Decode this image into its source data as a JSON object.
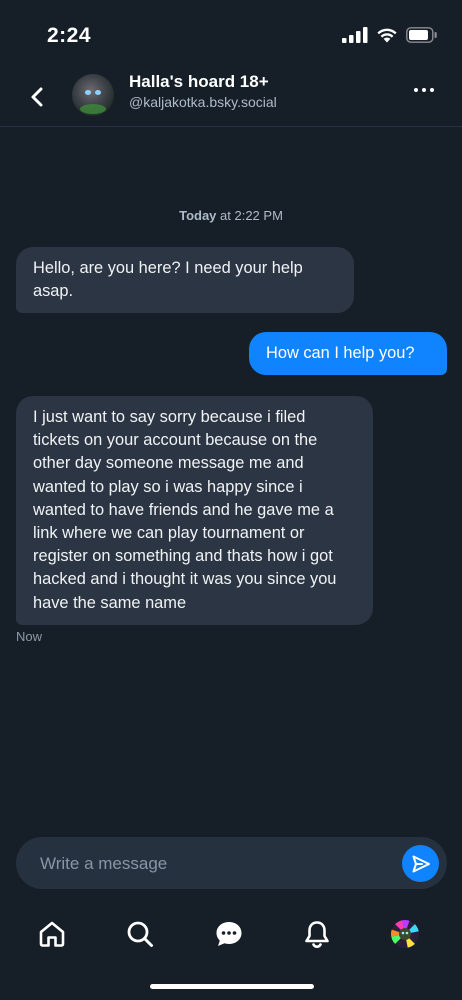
{
  "status_bar": {
    "time": "2:24"
  },
  "header": {
    "title": "Halla's hoard 18+",
    "handle": "@kaljakotka.bsky.social"
  },
  "conversation": {
    "date_label_bold": "Today",
    "date_label_rest": " at 2:22 PM",
    "messages": [
      {
        "direction": "incoming",
        "text": "Hello, are you here? I need your help asap."
      },
      {
        "direction": "outgoing",
        "text": "How can I help you?"
      },
      {
        "direction": "incoming",
        "text": "I just want to say sorry because i filed tickets on your account because on the other day someone message me and wanted to play so i was happy since i wanted to have friends and he gave me a link where we can play tournament or register on something and thats how i got hacked and i thought it was you since you have the same name"
      }
    ],
    "last_timestamp": "Now"
  },
  "composer": {
    "placeholder": "Write a message"
  },
  "tabbar": [
    "home-icon",
    "search-icon",
    "chat-icon",
    "notifications-icon",
    "profile-avatar"
  ],
  "colors": {
    "background": "#161e27",
    "bubble_incoming": "#2b3543",
    "bubble_outgoing": "#1083fe",
    "accent": "#1083fe"
  }
}
